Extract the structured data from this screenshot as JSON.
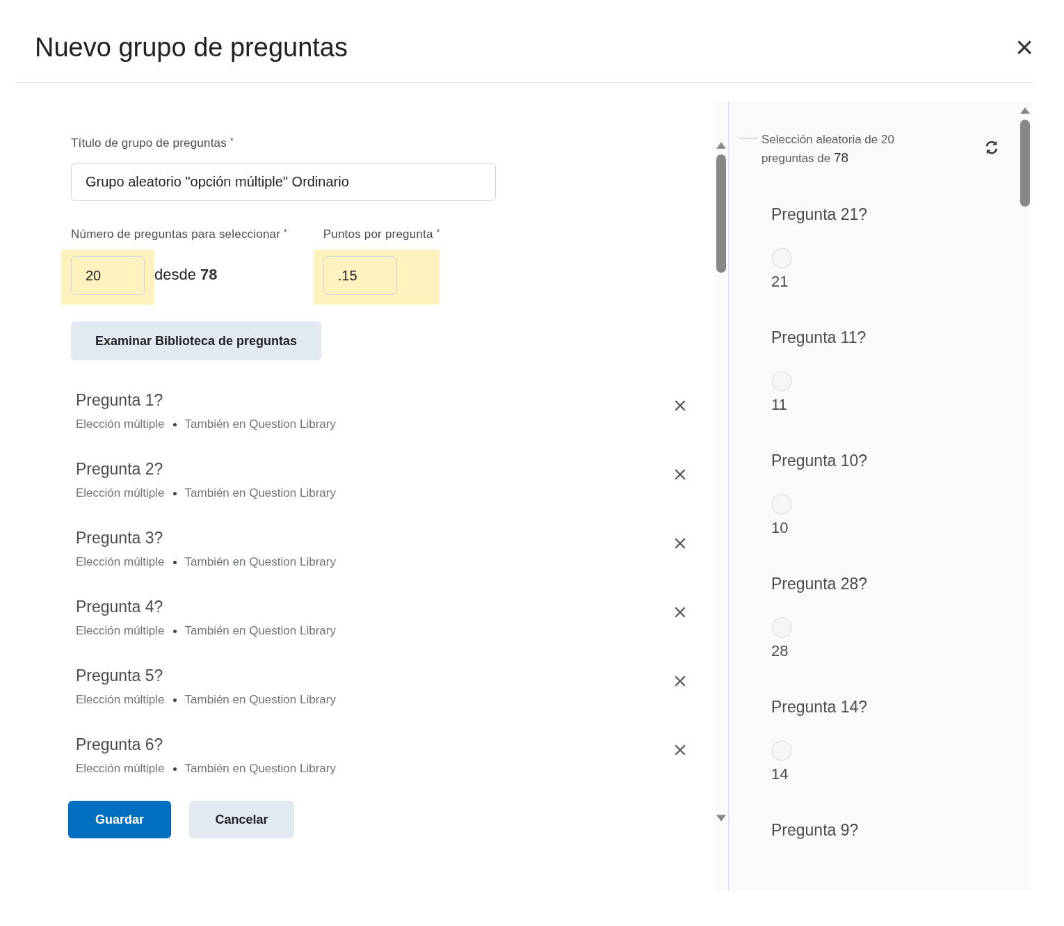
{
  "dialog": {
    "title": "Nuevo grupo de preguntas",
    "close": "×"
  },
  "form": {
    "title_field": {
      "label": "Título de grupo de preguntas",
      "required_mark": "*",
      "value": "Grupo aleatorio \"opción múltiple\" Ordinario"
    },
    "count_field": {
      "label": "Número de preguntas para seleccionar",
      "required_mark": "*",
      "value": "20",
      "highlighted": true,
      "suffix": "desde",
      "total": "78"
    },
    "points_field": {
      "label": "Puntos por pregunta",
      "required_mark": "*",
      "value": ".15",
      "highlighted": true
    },
    "browse_button": "Examinar Biblioteca de preguntas"
  },
  "questions": [
    {
      "title": "Pregunta 1?",
      "type": "Elección múltiple",
      "source": "También en Question Library"
    },
    {
      "title": "Pregunta 2?",
      "type": "Elección múltiple",
      "source": "También en Question Library"
    },
    {
      "title": "Pregunta 3?",
      "type": "Elección múltiple",
      "source": "También en Question Library"
    },
    {
      "title": "Pregunta 4?",
      "type": "Elección múltiple",
      "source": "También en Question Library"
    },
    {
      "title": "Pregunta 5?",
      "type": "Elección múltiple",
      "source": "También en Question Library"
    },
    {
      "title": "Pregunta 6?",
      "type": "Elección múltiple",
      "source": "También en Question Library"
    }
  ],
  "buttons": [
    {
      "label": "Guardar",
      "kind": "primary"
    },
    {
      "label": "Cancelar",
      "kind": "secondary"
    }
  ],
  "preview": {
    "summary": "Selección aleatoria de 20 preguntas de",
    "total": "78",
    "items": [
      {
        "title": "Pregunta 21?",
        "option": "21",
        "checked": false
      },
      {
        "title": "Pregunta 11?",
        "option": "11",
        "checked": false
      },
      {
        "title": "Pregunta 10?",
        "option": "10",
        "checked": false
      },
      {
        "title": "Pregunta 28?",
        "option": "28",
        "checked": false
      },
      {
        "title": "Pregunta 14?",
        "option": "14",
        "checked": false
      },
      {
        "title": "Pregunta 9?"
      }
    ]
  }
}
